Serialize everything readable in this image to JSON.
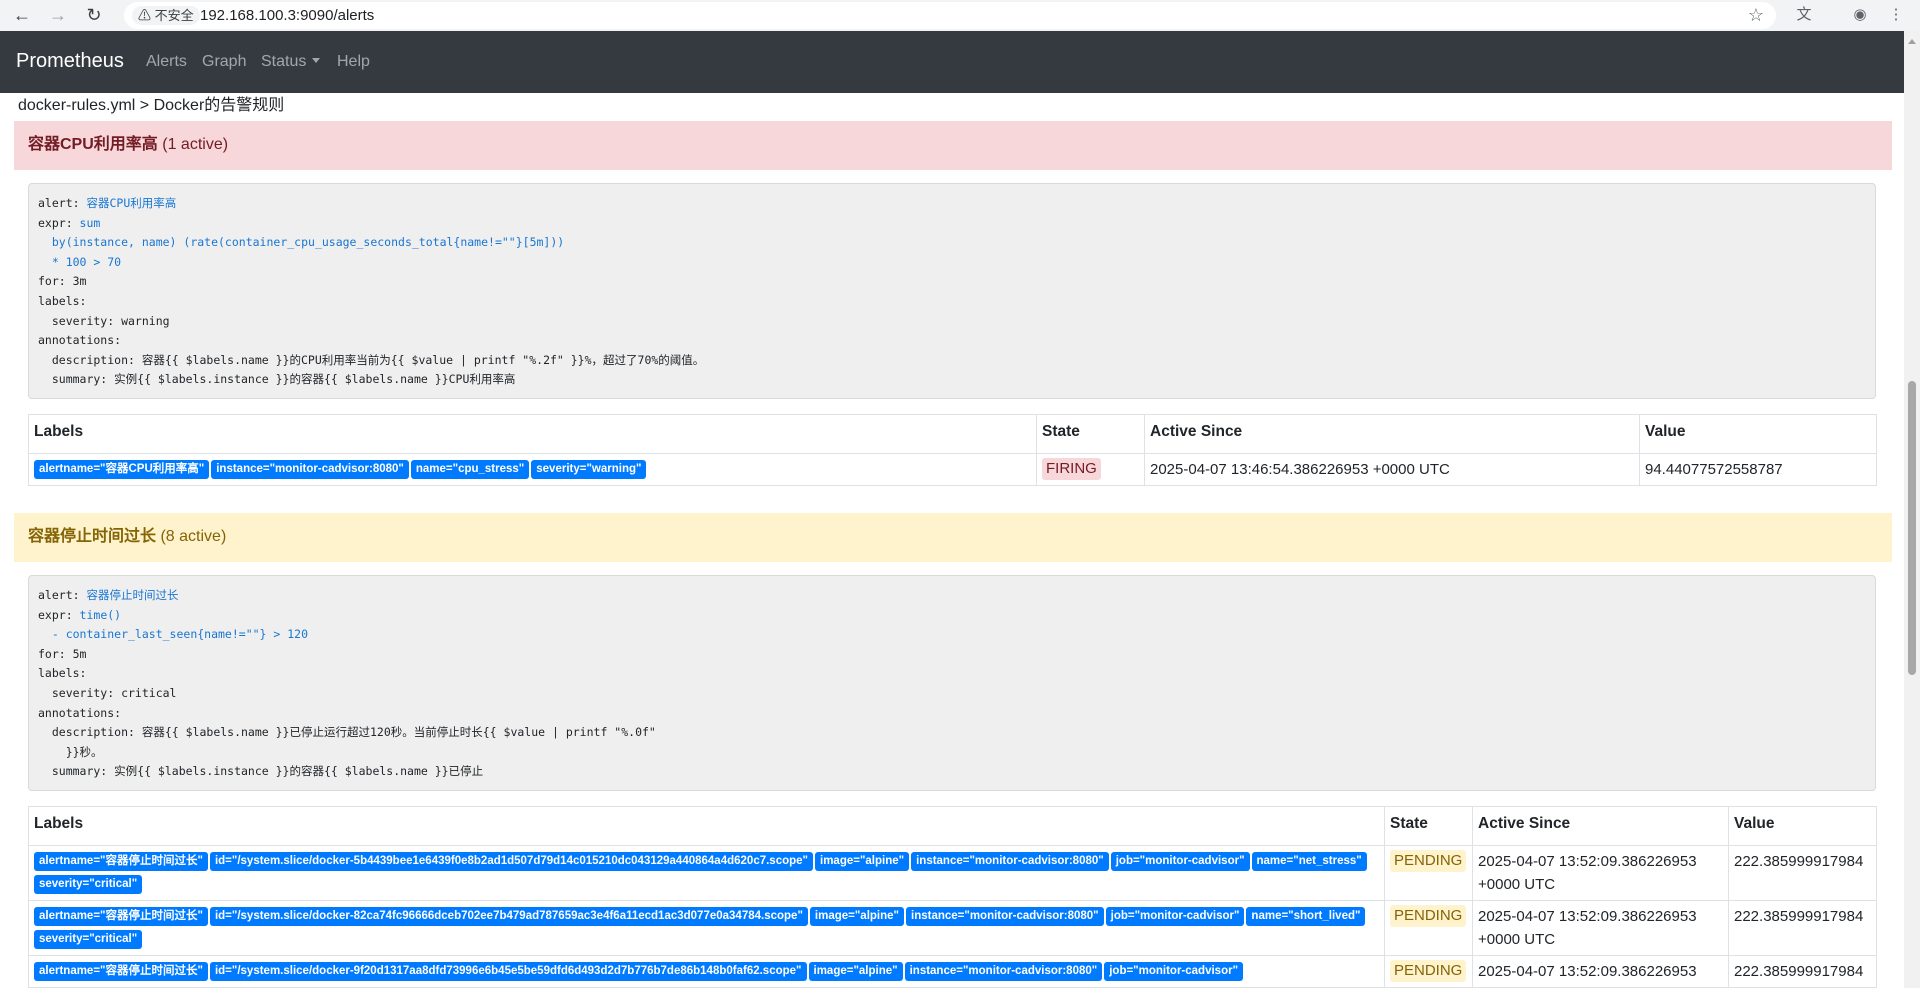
{
  "browser": {
    "security_label": "不安全",
    "url": "192.168.100.3:9090/alerts",
    "icons": [
      "back-icon",
      "forward-icon",
      "reload-icon",
      "warning-icon",
      "star-icon",
      "translate-icon",
      "profile-icon",
      "menu-icon"
    ]
  },
  "navbar": {
    "brand": "Prometheus",
    "links": [
      "Alerts",
      "Graph",
      "Status",
      "Help"
    ]
  },
  "group": {
    "title": "docker-rules.yml > Docker的告警规则"
  },
  "rules": [
    {
      "name": "容器CPU利用率高",
      "active": "(1 active)",
      "definition": {
        "alert_key": "alert: ",
        "alert_val": "容器CPU利用率高",
        "expr_key": "expr: ",
        "expr_lines": [
          "sum",
          "  by(instance, name) (rate(container_cpu_usage_seconds_total{name!=\"\"}[5m]))",
          "  * 100 > 70"
        ],
        "for_line": "for: 3m",
        "labels_line": "labels:",
        "label_lines": [
          "  severity: warning"
        ],
        "annotations_line": "annotations:",
        "annotation_lines": [
          "  description: 容器{{ $labels.name }}的CPU利用率当前为{{ $value | printf \"%.2f\" }}%，超过了70%的阈值。",
          "  summary: 实例{{ $labels.instance }}的容器{{ $labels.name }}CPU利用率高"
        ]
      },
      "table": {
        "headers": [
          "Labels",
          "State",
          "Active Since",
          "Value"
        ],
        "rows": [
          {
            "labels": [
              "alertname=\"容器CPU利用率高\"",
              "instance=\"monitor-cadvisor:8080\"",
              "name=\"cpu_stress\"",
              "severity=\"warning\""
            ],
            "state": "FIRING",
            "active_since": "2025-04-07 13:46:54.386226953 +0000 UTC",
            "value": "94.44077572558787"
          }
        ]
      }
    },
    {
      "name": "容器停止时间过长",
      "active": "(8 active)",
      "definition": {
        "alert_key": "alert: ",
        "alert_val": "容器停止时间过长",
        "expr_key": "expr: ",
        "expr_lines": [
          "time()",
          "  - container_last_seen{name!=\"\"} > 120"
        ],
        "for_line": "for: 5m",
        "labels_line": "labels:",
        "label_lines": [
          "  severity: critical"
        ],
        "annotations_line": "annotations:",
        "annotation_lines": [
          "  description: 容器{{ $labels.name }}已停止运行超过120秒。当前停止时长{{ $value | printf \"%.0f\"",
          "    }}秒。",
          "  summary: 实例{{ $labels.instance }}的容器{{ $labels.name }}已停止"
        ]
      },
      "table": {
        "headers": [
          "Labels",
          "State",
          "Active Since",
          "Value"
        ],
        "rows": [
          {
            "labels": [
              "alertname=\"容器停止时间过长\"",
              "id=\"/system.slice/docker-5b4439bee1e6439f0e8b2ad1d507d79d14c015210dc043129a440864a4d620c7.scope\"",
              "image=\"alpine\"",
              "instance=\"monitor-cadvisor:8080\"",
              "job=\"monitor-cadvisor\"",
              "name=\"net_stress\"",
              "severity=\"critical\""
            ],
            "state": "PENDING",
            "active_since": "2025-04-07 13:52:09.386226953 +0000 UTC",
            "value": "222.385999917984"
          },
          {
            "labels": [
              "alertname=\"容器停止时间过长\"",
              "id=\"/system.slice/docker-82ca74fc96666dceb702ee7b479ad787659ac3e4f6a11ecd1ac3d077e0a34784.scope\"",
              "image=\"alpine\"",
              "instance=\"monitor-cadvisor:8080\"",
              "job=\"monitor-cadvisor\"",
              "name=\"short_lived\"",
              "severity=\"critical\""
            ],
            "state": "PENDING",
            "active_since": "2025-04-07 13:52:09.386226953 +0000 UTC",
            "value": "222.385999917984"
          },
          {
            "labels": [
              "alertname=\"容器停止时间过长\"",
              "id=\"/system.slice/docker-9f20d1317aa8dfd73996e6b45e5be59dfd6d493d2d7b776b7de86b148b0faf62.scope\"",
              "image=\"alpine\"",
              "instance=\"monitor-cadvisor:8080\"",
              "job=\"monitor-cadvisor\""
            ],
            "state": "PENDING",
            "active_since": "2025-04-07 13:52:09.386226953",
            "value": "222.385999917984"
          }
        ]
      }
    }
  ]
}
